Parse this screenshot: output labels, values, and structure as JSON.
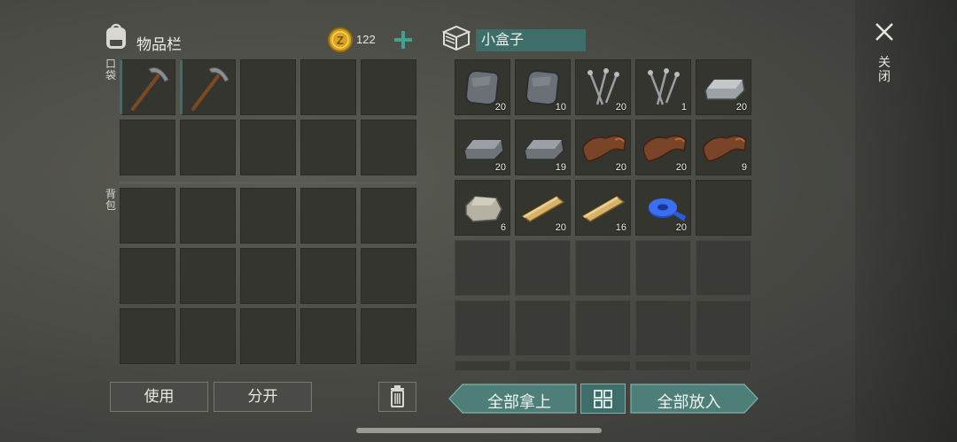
{
  "inventory": {
    "title": "物品栏",
    "coins": "122",
    "pocket_label": "口袋",
    "backpack_label": "背包",
    "pocket_items": [
      {
        "name": "pickaxe",
        "qty": ""
      },
      {
        "name": "pickaxe",
        "qty": ""
      }
    ]
  },
  "container": {
    "name_value": "小盒子",
    "items": [
      {
        "name": "iron-plate",
        "qty": "20"
      },
      {
        "name": "iron-plate",
        "qty": "10"
      },
      {
        "name": "nails",
        "qty": "20"
      },
      {
        "name": "nails",
        "qty": "1"
      },
      {
        "name": "metal-ingot",
        "qty": "20"
      },
      {
        "name": "metal-ingot-dark",
        "qty": "20"
      },
      {
        "name": "metal-ingot-dark",
        "qty": "19"
      },
      {
        "name": "leather",
        "qty": "20"
      },
      {
        "name": "leather",
        "qty": "20"
      },
      {
        "name": "leather",
        "qty": "9"
      },
      {
        "name": "stone",
        "qty": "6"
      },
      {
        "name": "plank",
        "qty": "20"
      },
      {
        "name": "plank",
        "qty": "16"
      },
      {
        "name": "blue-tape",
        "qty": "20"
      }
    ]
  },
  "buttons": {
    "use": "使用",
    "split": "分开",
    "take_all": "全部拿上",
    "put_all": "全部放入",
    "close": "关闭"
  },
  "colors": {
    "accent_teal": "#3d6e6a",
    "teal_button": "#4d7f78",
    "coin_gold": "#d9a520"
  }
}
